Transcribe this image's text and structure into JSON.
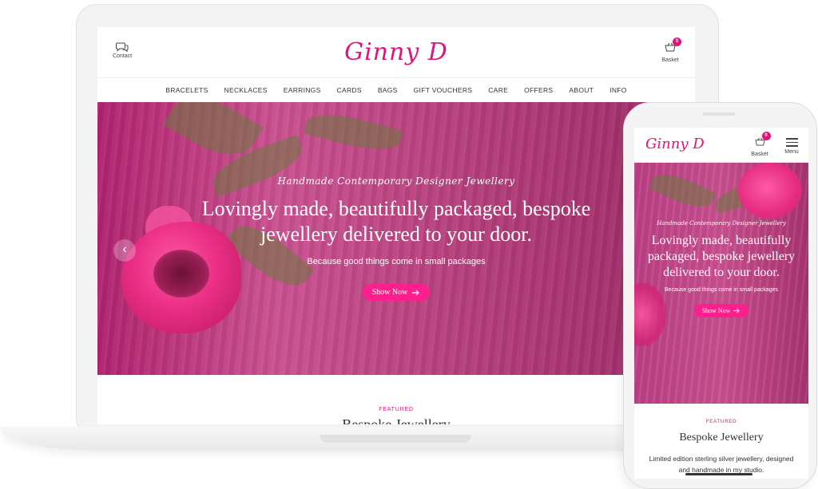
{
  "brand": {
    "logo": "Ginny D",
    "accent": "#e4127b",
    "button_color": "#ff1e8e"
  },
  "desktop": {
    "header": {
      "contact_label": "Contact",
      "basket_label": "Basket",
      "basket_count": "0"
    },
    "nav": [
      "BRACELETS",
      "NECKLACES",
      "EARRINGS",
      "CARDS",
      "BAGS",
      "GIFT VOUCHERS",
      "CARE",
      "OFFERS",
      "ABOUT",
      "INFO"
    ],
    "hero": {
      "tagline": "Handmade Contemporary Designer Jewellery",
      "headline": "Lovingly made, beautifully packaged, bespoke jewellery delivered to your door.",
      "subtext": "Because good things come in small packages",
      "button_label": "Show Now",
      "prev_icon": "chevron-left-icon"
    },
    "featured": {
      "label": "FEATURED",
      "title": "Bespoke Jewellery"
    }
  },
  "mobile": {
    "header": {
      "basket_label": "Basket",
      "basket_count": "0",
      "menu_label": "Menu"
    },
    "hero": {
      "tagline": "Handmade Contemporary Designer Jewellery",
      "headline": "Lovingly made, beautifully packaged, bespoke jewellery delivered to your door.",
      "subtext": "Because good things come in small packages",
      "button_label": "Show Now"
    },
    "featured": {
      "label": "FEATURED",
      "title": "Bespoke Jewellery",
      "description": "Limited edition sterling silver jewellery, designed and handmade in my studio."
    }
  }
}
